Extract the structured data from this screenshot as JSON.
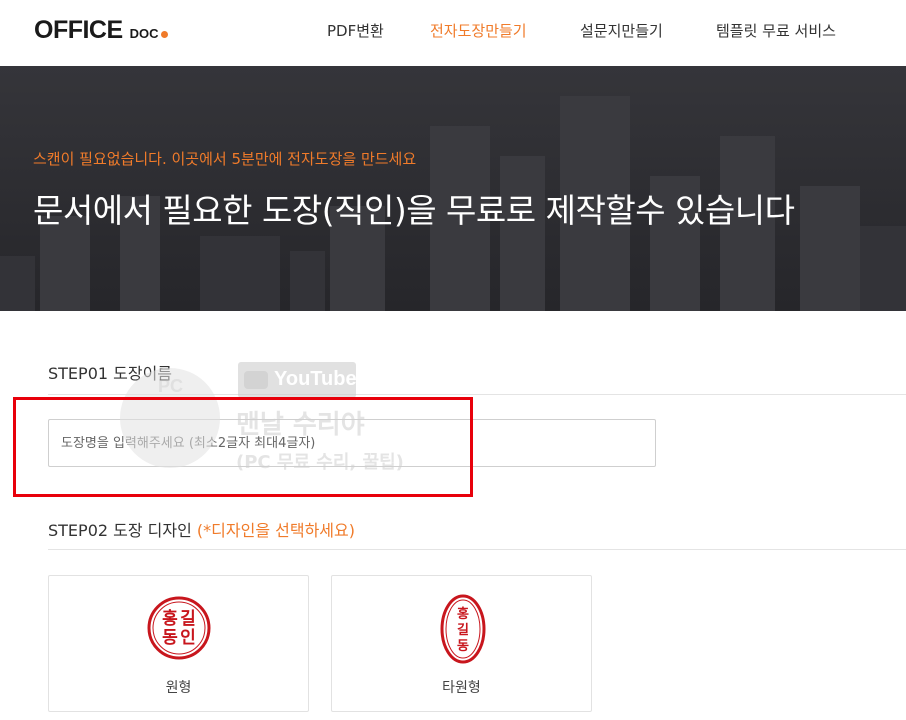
{
  "header": {
    "logo_main": "OFFICE",
    "logo_sub": "DOC",
    "nav": [
      "PDF변환",
      "전자도장만들기",
      "설문지만들기",
      "템플릿 무료 서비스"
    ],
    "active_nav": "전자도장만들기"
  },
  "hero": {
    "subtitle": "스캔이 필요없습니다. 이곳에서 5분만에 전자도장을 만드세요",
    "title": "문서에서 필요한 도장(직인)을 무료로 제작할수 있습니다"
  },
  "step1": {
    "label": "STEP01 도장이름",
    "input_value": "",
    "input_placeholder": "도장명을 입력해주세요 (최소2글자 최대4글자)"
  },
  "step2": {
    "label": "STEP02 도장 디자인",
    "hint": "(*디자인을 선택하세요)",
    "designs": [
      {
        "label": "원형",
        "chars": [
          "홍",
          "길",
          "동",
          "인"
        ]
      },
      {
        "label": "타원형",
        "chars": [
          "홍",
          "길",
          "동"
        ]
      }
    ]
  },
  "watermark": {
    "youtube": "YouTube",
    "line1": "맨날 수리야",
    "line2": "(PC 무료 수리, 꿀팁)",
    "badge": "PC"
  },
  "colors": {
    "accent": "#f07b2a",
    "seal_red": "#c8161d",
    "highlight": "#e8000b",
    "hero_bg": "#2d2d30"
  }
}
